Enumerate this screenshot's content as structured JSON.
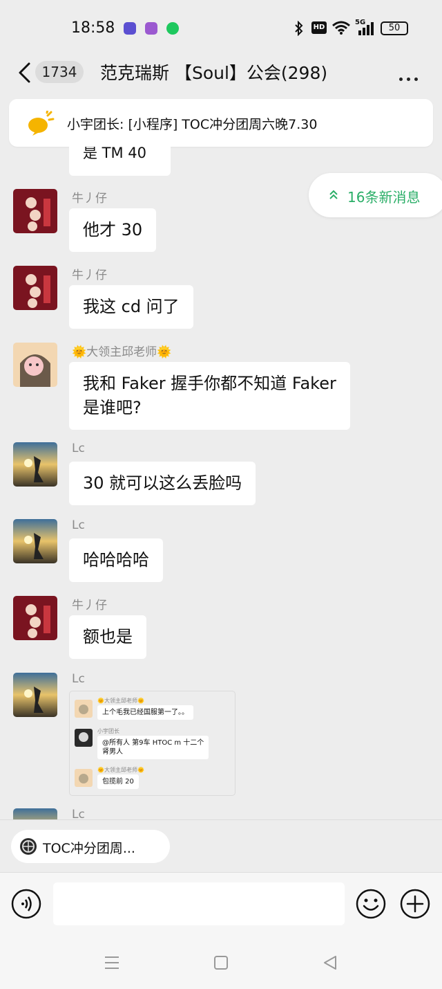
{
  "status_bar": {
    "time": "18:58",
    "notification_colors": [
      "#6c5ce7",
      "#8e44ad",
      "#2ecc71"
    ],
    "battery": "50",
    "network": "5G",
    "hd": "HD"
  },
  "header": {
    "unread_count": "1734",
    "title": "范克瑞斯 【Soul】公会(298)"
  },
  "pinned": {
    "text": "小宇团长: [小程序] TOC冲分团周六晚7.30"
  },
  "new_messages": {
    "label": "16条新消息"
  },
  "partial_message": {
    "text": "是 TM 40"
  },
  "messages": [
    {
      "sender": "牛丿仔",
      "text": "他才 30",
      "avatar": "red-poster"
    },
    {
      "sender": "牛丿仔",
      "text": "我这 cd 问了",
      "avatar": "red-poster"
    },
    {
      "sender": "🌞大领主邱老师🌞",
      "text": "我和 Faker 握手你都不知道 Faker\n是谁吧?",
      "avatar": "cartoon-girl"
    },
    {
      "sender": "Lc",
      "text": "30 就可以这么丢脸吗",
      "avatar": "sunset"
    },
    {
      "sender": "Lc",
      "text": "哈哈哈哈",
      "avatar": "sunset"
    },
    {
      "sender": "牛丿仔",
      "text": "额也是",
      "avatar": "red-poster"
    },
    {
      "sender": "Lc",
      "text": "",
      "avatar": "sunset"
    },
    {
      "sender": "Lc",
      "text": "",
      "avatar": "sunset"
    }
  ],
  "image_message": {
    "rows": [
      {
        "name": "🌞大领主邱老师🌞",
        "text": "上个毛我已经国服第一了。。"
      },
      {
        "name": "小宇团长",
        "text": "@所有人 第9车 HTOC m 十二个\n肾男人"
      },
      {
        "name": "🌞大领主邱老师🌞",
        "text": "包揽前 20"
      }
    ]
  },
  "quote_bar": {
    "text": "TOC冲分团周..."
  },
  "input": {
    "value": "",
    "placeholder": ""
  },
  "colors": {
    "accent_green": "#2aae67",
    "background": "#ededed",
    "bubble": "#ffffff"
  }
}
